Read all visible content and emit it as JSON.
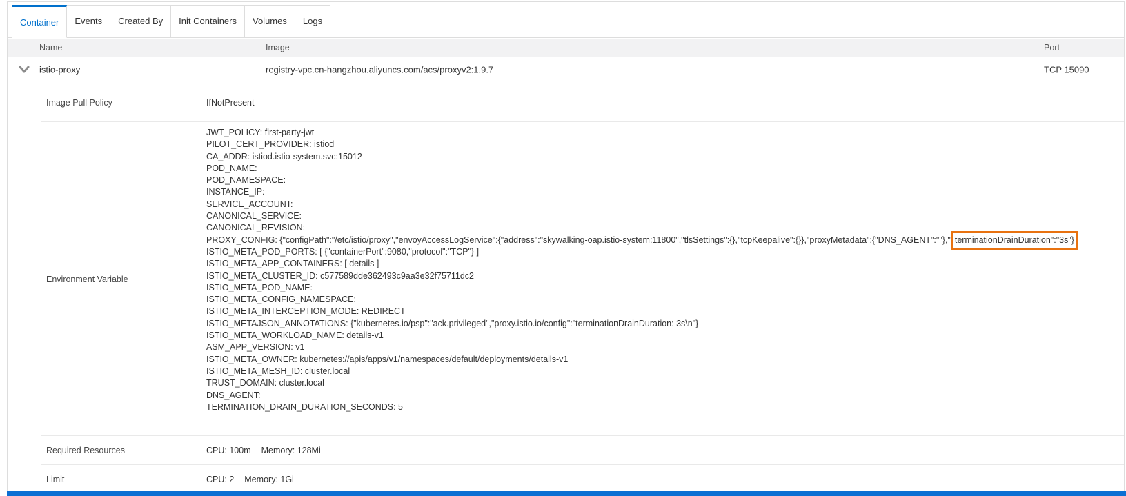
{
  "tabs": {
    "items": [
      {
        "label": "Container",
        "active": true
      },
      {
        "label": "Events",
        "active": false
      },
      {
        "label": "Created By",
        "active": false
      },
      {
        "label": "Init Containers",
        "active": false
      },
      {
        "label": "Volumes",
        "active": false
      },
      {
        "label": "Logs",
        "active": false
      }
    ]
  },
  "table": {
    "columns": {
      "name": "Name",
      "image": "Image",
      "port": "Port"
    },
    "row": {
      "name": "istio-proxy",
      "image": "registry-vpc.cn-hangzhou.aliyuncs.com/acs/proxyv2:1.9.7",
      "port": "TCP 15090",
      "expand_icon": "chevron-down-icon",
      "expanded": true
    }
  },
  "details": {
    "image_pull_policy": {
      "label": "Image Pull Policy",
      "value": "IfNotPresent"
    },
    "environment_variable": {
      "label": "Environment Variable",
      "lines": [
        "JWT_POLICY: first-party-jwt",
        "PILOT_CERT_PROVIDER: istiod",
        "CA_ADDR: istiod.istio-system.svc:15012",
        "POD_NAME:",
        "POD_NAMESPACE:",
        "INSTANCE_IP:",
        "SERVICE_ACCOUNT:",
        "CANONICAL_SERVICE:",
        "CANONICAL_REVISION:",
        {
          "pre": "PROXY_CONFIG: {\"configPath\":\"/etc/istio/proxy\",\"envoyAccessLogService\":{\"address\":\"skywalking-oap.istio-system:11800\",\"tlsSettings\":{},\"tcpKeepalive\":{}},\"proxyMetadata\":{\"DNS_AGENT\":\"\"},\"",
          "highlight": "terminationDrainDuration\":\"3s\"}"
        },
        "ISTIO_META_POD_PORTS: [ {\"containerPort\":9080,\"protocol\":\"TCP\"} ]",
        "ISTIO_META_APP_CONTAINERS: [ details ]",
        "ISTIO_META_CLUSTER_ID: c577589dde362493c9aa3e32f75711dc2",
        "ISTIO_META_POD_NAME:",
        "ISTIO_META_CONFIG_NAMESPACE:",
        "ISTIO_META_INTERCEPTION_MODE: REDIRECT",
        "ISTIO_METAJSON_ANNOTATIONS: {\"kubernetes.io/psp\":\"ack.privileged\",\"proxy.istio.io/config\":\"terminationDrainDuration: 3s\\n\"}",
        "ISTIO_META_WORKLOAD_NAME: details-v1",
        "ASM_APP_VERSION: v1",
        "ISTIO_META_OWNER: kubernetes://apis/apps/v1/namespaces/default/deployments/details-v1",
        "ISTIO_META_MESH_ID: cluster.local",
        "TRUST_DOMAIN: cluster.local",
        "DNS_AGENT:",
        "TERMINATION_DRAIN_DURATION_SECONDS: 5"
      ]
    },
    "required_resources": {
      "label": "Required Resources",
      "cpu": "CPU: 100m",
      "memory": "Memory: 128Mi"
    },
    "limit": {
      "label": "Limit",
      "cpu": "CPU: 2",
      "memory": "Memory: 1Gi"
    }
  },
  "colors": {
    "accent_blue": "#0070cc",
    "bottom_bar_blue": "#0b6fd3",
    "highlight_orange": "#e87210",
    "header_bg": "#f2f2f3",
    "border_gray": "#dddddd",
    "text_primary": "#333333",
    "text_secondary": "#555555"
  }
}
